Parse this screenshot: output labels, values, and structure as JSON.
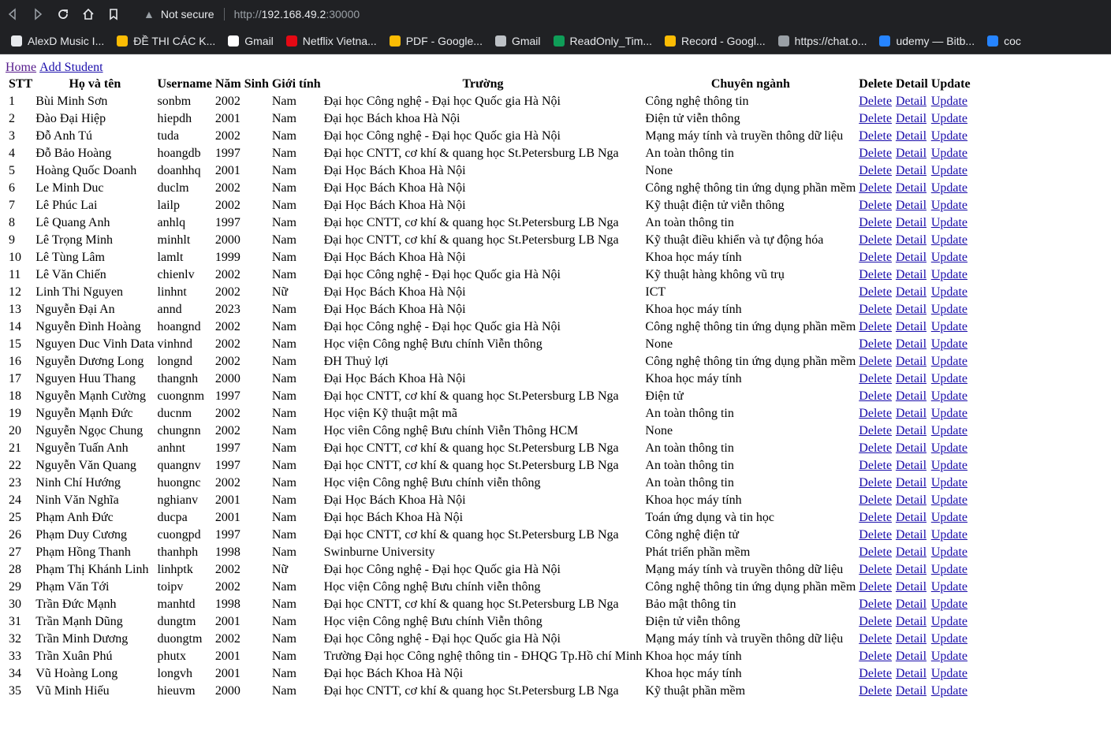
{
  "browser": {
    "security_label": "Not secure",
    "url_protocol": "http://",
    "url_host": "192.168.49.2",
    "url_port": ":30000"
  },
  "bookmarks": [
    {
      "label": "AlexD Music I...",
      "color": "#e8eaed"
    },
    {
      "label": "ĐỀ THI CÁC K...",
      "color": "#fbbc04"
    },
    {
      "label": "Gmail",
      "color": "#ffffff"
    },
    {
      "label": "Netflix Vietna...",
      "color": "#e50914"
    },
    {
      "label": "PDF - Google...",
      "color": "#fbbc04"
    },
    {
      "label": "Gmail",
      "color": "#bdc1c6"
    },
    {
      "label": "ReadOnly_Tim...",
      "color": "#0f9d58"
    },
    {
      "label": "Record - Googl...",
      "color": "#fbbc04"
    },
    {
      "label": "https://chat.o...",
      "color": "#9aa0a6"
    },
    {
      "label": "udemy — Bitb...",
      "color": "#2684ff"
    },
    {
      "label": "coc",
      "color": "#2684ff"
    }
  ],
  "nav": {
    "home": "Home",
    "add_student": "Add Student"
  },
  "table": {
    "headers": [
      "STT",
      "Họ và tên",
      "Username",
      "Năm Sinh",
      "Giới tính",
      "Trường",
      "Chuyên ngành",
      "Delete",
      "Detail",
      "Update"
    ],
    "action_labels": {
      "delete": "Delete",
      "detail": "Detail",
      "update": "Update"
    },
    "rows": [
      [
        "1",
        "Bùi Minh Sơn",
        "sonbm",
        "2002",
        "Nam",
        "Đại học Công nghệ - Đại học Quốc gia Hà Nội",
        "Công nghệ thông tin"
      ],
      [
        "2",
        "Đào Đại Hiệp",
        "hiepdh",
        "2001",
        "Nam",
        "Đại học Bách khoa Hà Nội",
        "Điện tử viễn thông"
      ],
      [
        "3",
        "Đỗ Anh Tú",
        "tuda",
        "2002",
        "Nam",
        "Đại học Công nghệ - Đại học Quốc gia Hà Nội",
        "Mạng máy tính và truyền thông dữ liệu"
      ],
      [
        "4",
        "Đỗ Bảo Hoàng",
        "hoangdb",
        "1997",
        "Nam",
        "Đại học CNTT, cơ khí & quang học St.Petersburg LB Nga",
        "An toàn thông tin"
      ],
      [
        "5",
        "Hoàng Quốc Doanh",
        "doanhhq",
        "2001",
        "Nam",
        "Đại Học Bách Khoa Hà Nội",
        "None"
      ],
      [
        "6",
        "Le Minh Duc",
        "duclm",
        "2002",
        "Nam",
        "Đại Học Bách Khoa Hà Nội",
        "Công nghệ thông tin ứng dụng phần mềm"
      ],
      [
        "7",
        "Lê Phúc Lai",
        "lailp",
        "2002",
        "Nam",
        "Đại Học Bách Khoa Hà Nội",
        "Kỹ thuật điện tử viễn thông"
      ],
      [
        "8",
        "Lê Quang Anh",
        "anhlq",
        "1997",
        "Nam",
        "Đại học CNTT, cơ khí & quang học St.Petersburg LB Nga",
        "An toàn thông tin"
      ],
      [
        "9",
        "Lê Trọng Minh",
        "minhlt",
        "2000",
        "Nam",
        "Đại học CNTT, cơ khí & quang học St.Petersburg LB Nga",
        "Kỹ thuật điều khiển và tự động hóa"
      ],
      [
        "10",
        "Lê Tùng Lâm",
        "lamlt",
        "1999",
        "Nam",
        "Đại Học Bách Khoa Hà Nội",
        "Khoa học máy tính"
      ],
      [
        "11",
        "Lê Văn Chiến",
        "chienlv",
        "2002",
        "Nam",
        "Đại học Công nghệ - Đại học Quốc gia Hà Nội",
        "Kỹ thuật hàng không vũ trụ"
      ],
      [
        "12",
        "Linh Thi Nguyen",
        "linhnt",
        "2002",
        "Nữ",
        "Đại Học Bách Khoa Hà Nội",
        "ICT"
      ],
      [
        "13",
        "Nguyễn Đại An",
        "annd",
        "2023",
        "Nam",
        "Đại Học Bách Khoa Hà Nội",
        "Khoa học máy tính"
      ],
      [
        "14",
        "Nguyễn Đình Hoàng",
        "hoangnd",
        "2002",
        "Nam",
        "Đại học Công nghệ - Đại học Quốc gia Hà Nội",
        "Công nghệ thông tin ứng dụng phần mềm"
      ],
      [
        "15",
        "Nguyen Duc Vinh Data",
        "vinhnd",
        "2002",
        "Nam",
        "Học viện Công nghệ Bưu chính Viễn thông",
        "None"
      ],
      [
        "16",
        "Nguyễn Dương Long",
        "longnd",
        "2002",
        "Nam",
        "ĐH Thuỷ lợi",
        "Công nghệ thông tin ứng dụng phần mềm"
      ],
      [
        "17",
        "Nguyen Huu Thang",
        "thangnh",
        "2000",
        "Nam",
        "Đại Học Bách Khoa Hà Nội",
        "Khoa học máy tính"
      ],
      [
        "18",
        "Nguyễn Mạnh Cường",
        "cuongnm",
        "1997",
        "Nam",
        "Đại học CNTT, cơ khí & quang học St.Petersburg LB Nga",
        "Điện tử"
      ],
      [
        "19",
        "Nguyễn Mạnh Đức",
        "ducnm",
        "2002",
        "Nam",
        "Học viện Kỹ thuật mật mã",
        "An toàn thông tin"
      ],
      [
        "20",
        "Nguyễn Ngọc Chung",
        "chungnn",
        "2002",
        "Nam",
        "Học viên Công nghệ Bưu chính Viễn Thông HCM",
        "None"
      ],
      [
        "21",
        "Nguyễn Tuấn Anh",
        "anhnt",
        "1997",
        "Nam",
        "Đại học CNTT, cơ khí & quang học St.Petersburg LB Nga",
        "An toàn thông tin"
      ],
      [
        "22",
        "Nguyễn Văn Quang",
        "quangnv",
        "1997",
        "Nam",
        "Đại học CNTT, cơ khí & quang học St.Petersburg LB Nga",
        "An toàn thông tin"
      ],
      [
        "23",
        "Ninh Chí Hướng",
        "huongnc",
        "2002",
        "Nam",
        "Học viện Công nghệ Bưu chính viễn thông",
        "An toàn thông tin"
      ],
      [
        "24",
        "Ninh Văn Nghĩa",
        "nghianv",
        "2001",
        "Nam",
        "Đại Học Bách Khoa Hà Nội",
        "Khoa học máy tính"
      ],
      [
        "25",
        "Phạm Anh Đức",
        "ducpa",
        "2001",
        "Nam",
        "Đại học Bách Khoa Hà Nội",
        "Toán ứng dụng và tin học"
      ],
      [
        "26",
        "Phạm Duy Cương",
        "cuongpd",
        "1997",
        "Nam",
        "Đại học CNTT, cơ khí & quang học St.Petersburg LB Nga",
        "Công nghệ điện tử"
      ],
      [
        "27",
        "Phạm Hồng Thanh",
        "thanhph",
        "1998",
        "Nam",
        "Swinburne University",
        "Phát triển phần mềm"
      ],
      [
        "28",
        "Phạm Thị Khánh Linh",
        "linhptk",
        "2002",
        "Nữ",
        "Đại học Công nghệ - Đại học Quốc gia Hà Nội",
        "Mạng máy tính và truyền thông dữ liệu"
      ],
      [
        "29",
        "Phạm Văn Tới",
        "toipv",
        "2002",
        "Nam",
        "Học viện Công nghệ Bưu chính viễn thông",
        "Công nghệ thông tin ứng dụng phần mềm"
      ],
      [
        "30",
        "Trần Đức Mạnh",
        "manhtd",
        "1998",
        "Nam",
        "Đại học CNTT, cơ khí & quang học St.Petersburg LB Nga",
        "Bảo mật thông tin"
      ],
      [
        "31",
        "Trần Mạnh Dũng",
        "dungtm",
        "2001",
        "Nam",
        "Học viện Công nghệ Bưu chính Viễn thông",
        "Điện tử viễn thông"
      ],
      [
        "32",
        "Trần Minh Dương",
        "duongtm",
        "2002",
        "Nam",
        "Đại học Công nghệ - Đại học Quốc gia Hà Nội",
        "Mạng máy tính và truyền thông dữ liệu"
      ],
      [
        "33",
        "Trần Xuân Phú",
        "phutx",
        "2001",
        "Nam",
        "Trường Đại học Công nghệ thông tin - ĐHQG Tp.Hồ chí Minh",
        "Khoa học máy tính"
      ],
      [
        "34",
        "Vũ Hoàng Long",
        "longvh",
        "2001",
        "Nam",
        "Đại học Bách Khoa Hà Nội",
        "Khoa học máy tính"
      ],
      [
        "35",
        "Vũ Minh Hiếu",
        "hieuvm",
        "2000",
        "Nam",
        "Đại học CNTT, cơ khí & quang học St.Petersburg LB Nga",
        "Kỹ thuật phần mềm"
      ]
    ]
  }
}
